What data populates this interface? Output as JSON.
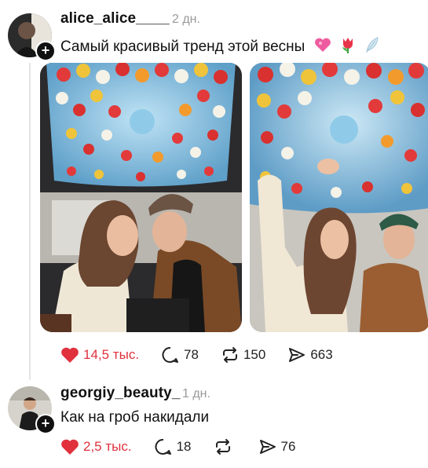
{
  "post": {
    "username": "alice_alice____",
    "time": "2 дн.",
    "text": "Самый красивый тренд этой весны",
    "emojis": [
      "heart-emoji",
      "tulip-emoji",
      "feather-emoji"
    ],
    "images": [
      {
        "alt_icon": "couple-kiss-tulip-roof-photo"
      },
      {
        "alt_icon": "couple-tulip-roof-photo"
      }
    ],
    "actions": {
      "likes": "14,5 тыс.",
      "comments": "78",
      "reposts": "150",
      "shares": "663"
    },
    "liked": true
  },
  "reply": {
    "username": "georgiy_beauty_",
    "time": "1 дн.",
    "text": "Как на гроб накидали",
    "actions": {
      "likes": "2,5 тыс.",
      "comments": "18",
      "reposts": "",
      "shares": "76"
    },
    "liked": true
  },
  "colors": {
    "like": "#e0313d",
    "muted": "#9a9a9a",
    "text": "#111111"
  }
}
